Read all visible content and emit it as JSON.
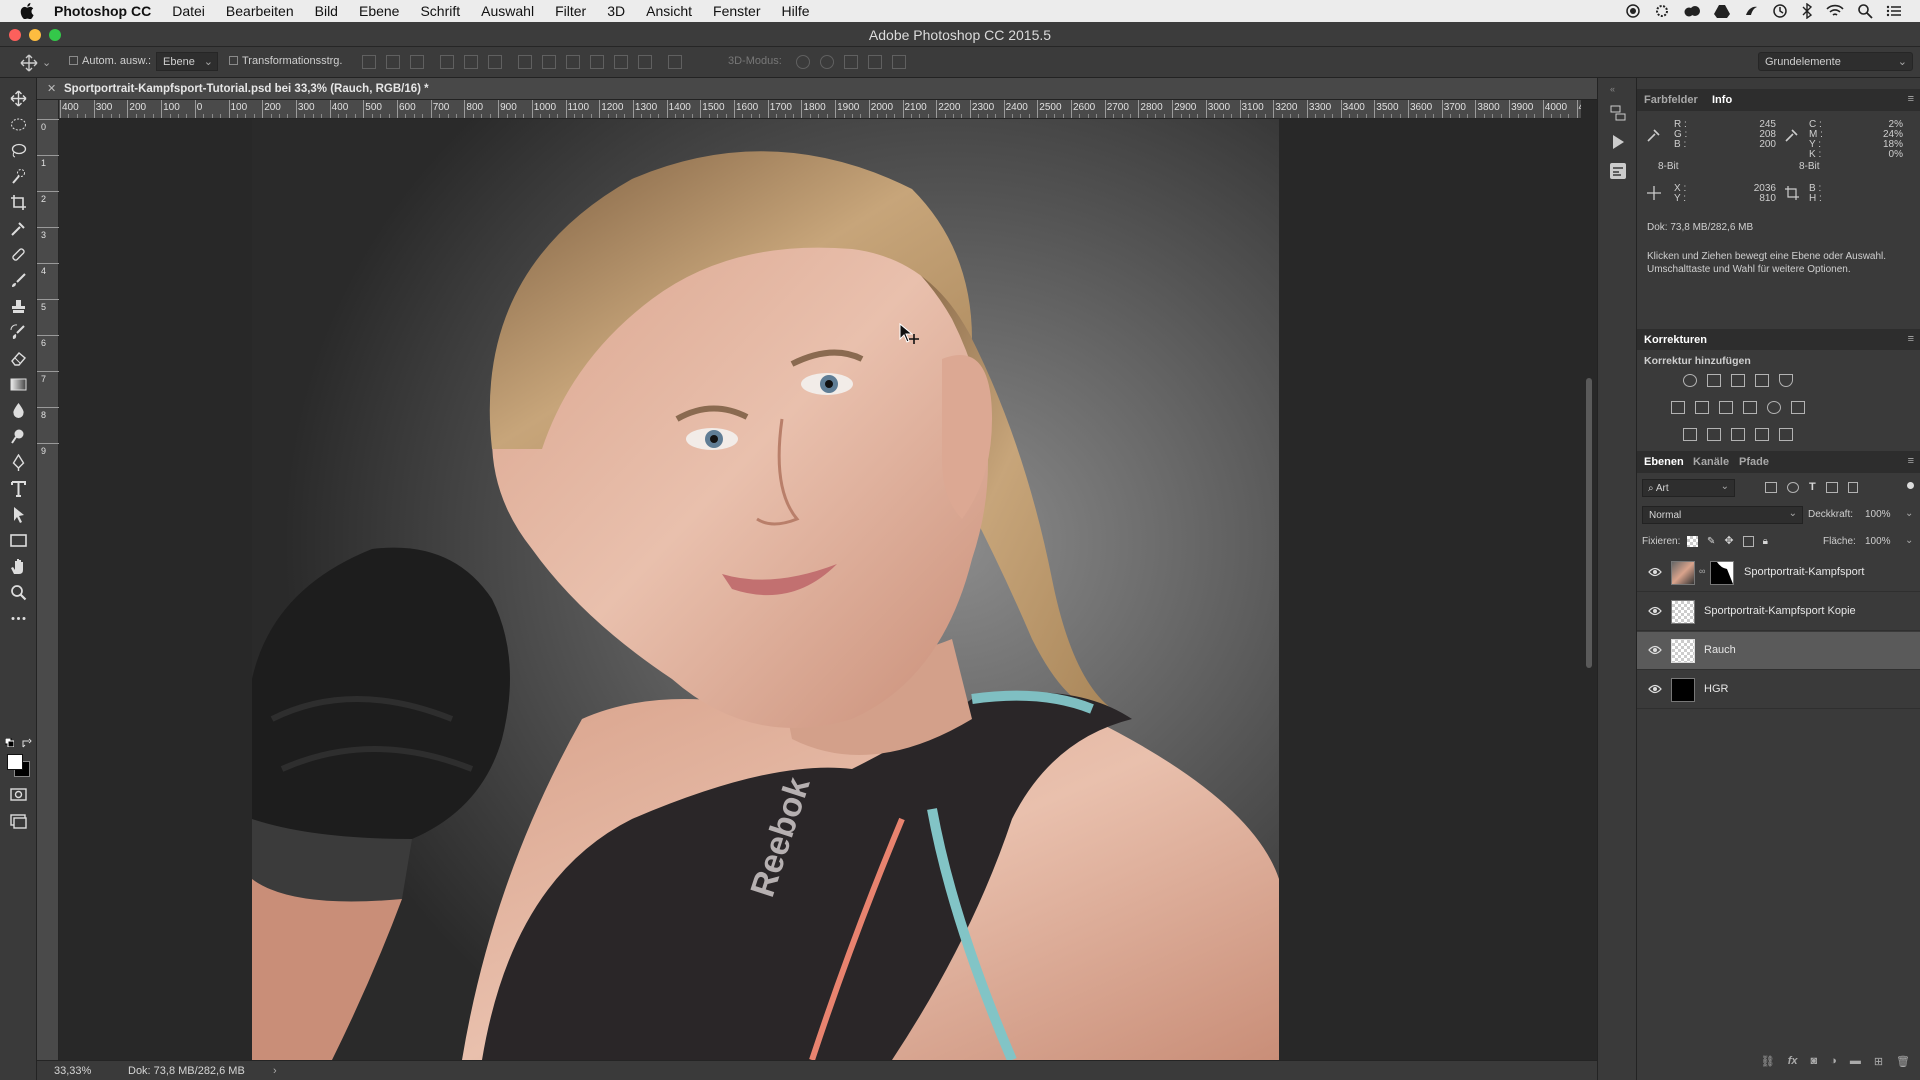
{
  "menubar": {
    "app_name": "Photoshop CC",
    "items": [
      "Datei",
      "Bearbeiten",
      "Bild",
      "Ebene",
      "Schrift",
      "Auswahl",
      "Filter",
      "3D",
      "Ansicht",
      "Fenster",
      "Hilfe"
    ]
  },
  "window": {
    "title": "Adobe Photoshop CC 2015.5"
  },
  "options": {
    "auto_select_label": "Autom. ausw.:",
    "auto_select_value": "Ebene",
    "transform_label": "Transformationsstrg.",
    "mode3d_label": "3D-Modus:",
    "workspace": "Grundelemente"
  },
  "document": {
    "tab_title": "Sportportrait-Kampfsport-Tutorial.psd bei 33,3% (Rauch, RGB/16) *",
    "zoom": "33,33%",
    "doc_size": "Dok: 73,8 MB/282,6 MB",
    "status_arrow": "›"
  },
  "ruler": {
    "h_labels": [
      "400",
      "300",
      "200",
      "100",
      "0",
      "100",
      "200",
      "300",
      "400",
      "500",
      "600",
      "700",
      "800",
      "900",
      "1000",
      "1100",
      "1200",
      "1300",
      "1400",
      "1500",
      "1600",
      "1700",
      "1800",
      "1900",
      "2000",
      "2100",
      "2200",
      "2300",
      "2400",
      "2500",
      "2600",
      "2700",
      "2800",
      "2900",
      "3000",
      "3100",
      "3200",
      "3300",
      "3400",
      "3500",
      "3600",
      "3700",
      "3800",
      "3900",
      "4000",
      "410"
    ],
    "v_labels": [
      "0",
      "1",
      "2",
      "3",
      "4",
      "5",
      "6",
      "7",
      "8",
      "9"
    ]
  },
  "info_panel": {
    "tabs": [
      "Farbfelder",
      "Info"
    ],
    "r_label": "R :",
    "g_label": "G :",
    "b_label": "B :",
    "r": "245",
    "g": "208",
    "b": "200",
    "rgb_bits": "8-Bit",
    "c_label": "C :",
    "m_label": "M :",
    "y_label": "Y :",
    "k_label": "K :",
    "c": "2%",
    "m": "24%",
    "y": "18%",
    "k": "0%",
    "cmyk_bits": "8-Bit",
    "x_label": "X :",
    "y_coord_label": "Y :",
    "x": "2036",
    "y_coord": "810",
    "w_label": "B :",
    "h_label": "H :",
    "doc_size": "Dok: 73,8 MB/282,6 MB",
    "hint": "Klicken und Ziehen bewegt eine Ebene oder Auswahl. Umschalttaste und Wahl für weitere Optionen."
  },
  "adjustments_panel": {
    "title": "Korrekturen",
    "subtitle": "Korrektur hinzufügen"
  },
  "layers_panel": {
    "tabs": [
      "Ebenen",
      "Kanäle",
      "Pfade"
    ],
    "filter_kind": "Art",
    "blend_mode": "Normal",
    "opacity_label": "Deckkraft:",
    "opacity": "100%",
    "lock_label": "Fixieren:",
    "fill_label": "Fläche:",
    "fill": "100%",
    "layers": [
      {
        "name": "Sportportrait-Kampfsport"
      },
      {
        "name": "Sportportrait-Kampfsport Kopie"
      },
      {
        "name": "Rauch"
      },
      {
        "name": "HGR"
      }
    ]
  }
}
